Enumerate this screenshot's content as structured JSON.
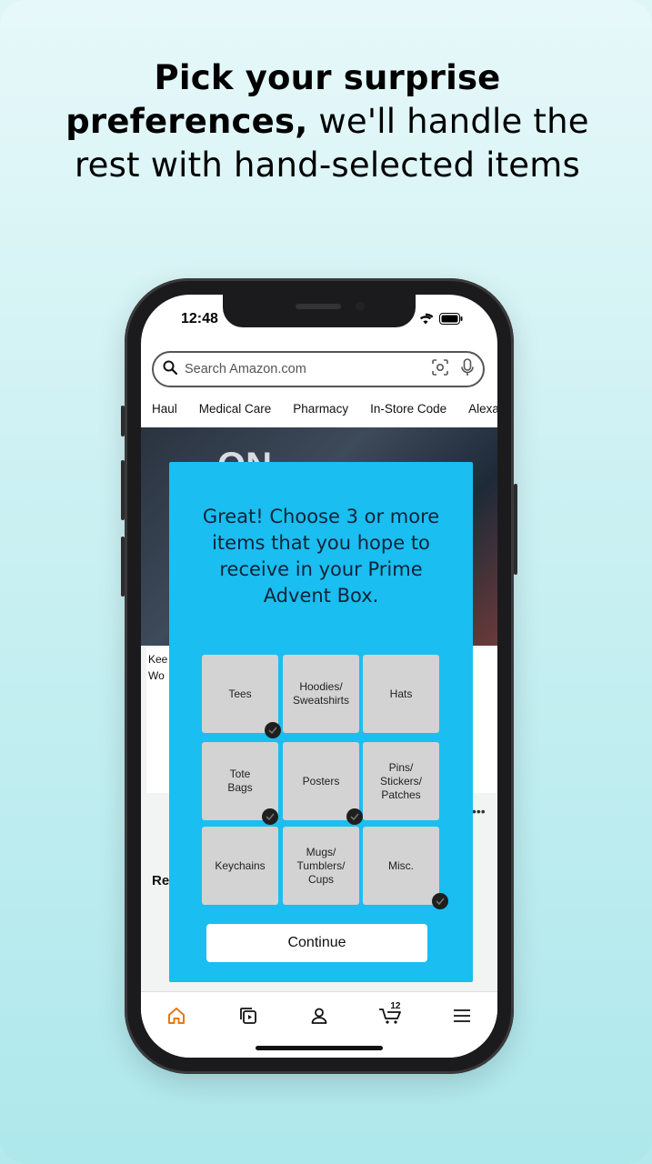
{
  "headline": {
    "bold": "Pick your surprise preferences,",
    "regular": " we'll handle the rest with hand-selected items"
  },
  "status_bar": {
    "time": "12:48"
  },
  "search": {
    "placeholder": "Search Amazon.com"
  },
  "nav_links": [
    "Haul",
    "Medical Care",
    "Pharmacy",
    "In-Store Code",
    "Alexa"
  ],
  "background_page": {
    "hero_text": "ON",
    "card_text": "Kee Wo",
    "section_heading": "Re"
  },
  "modal": {
    "title": "Great! Choose 3 or more items that you hope to receive in your Prime Advent Box.",
    "tiles": [
      {
        "label": "Tees",
        "checked": true
      },
      {
        "label": "Hoodies/ Sweatshirts",
        "checked": false
      },
      {
        "label": "Hats",
        "checked": false
      },
      {
        "label": "Tote Bags",
        "checked": true
      },
      {
        "label": "Posters",
        "checked": true
      },
      {
        "label": "Pins/ Stickers/ Patches",
        "checked": false
      },
      {
        "label": "Keychains",
        "checked": false
      },
      {
        "label": "Mugs/ Tumblers/ Cups",
        "checked": false
      },
      {
        "label": "Misc.",
        "checked": true
      }
    ],
    "continue_label": "Continue"
  },
  "bottom_nav": {
    "cart_count": "12",
    "tabs": [
      "home-icon",
      "video-icon",
      "account-icon",
      "cart-icon",
      "menu-icon"
    ]
  },
  "colors": {
    "modal_bg": "#1abef0",
    "tile_bg": "#d3d3d3",
    "active_tab": "#e47911"
  }
}
